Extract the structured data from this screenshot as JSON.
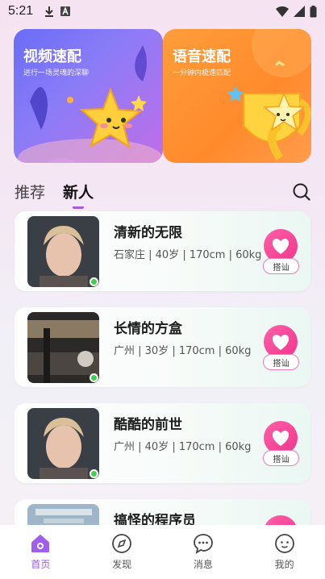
{
  "status_bar": {
    "time": "5:21"
  },
  "promos": [
    {
      "title": "视频速配",
      "subtitle": "进行一场灵魂的深聊"
    },
    {
      "title": "语音速配",
      "subtitle": "一分钟内极速匹配"
    }
  ],
  "tabs": [
    {
      "label": "推荐"
    },
    {
      "label": "新人"
    }
  ],
  "users": [
    {
      "name": "清新的无限",
      "info": "石家庄 | 40岁 | 170cm | 60kg",
      "chat_label": "搭讪"
    },
    {
      "name": "长情的方盒",
      "info": "广州 | 30岁 | 170cm | 60kg",
      "chat_label": "搭讪"
    },
    {
      "name": "酷酷的前世",
      "info": "广州 | 40岁 | 170cm | 60kg",
      "chat_label": "搭讪"
    },
    {
      "name": "搞怪的程序员",
      "info": "",
      "chat_label": ""
    }
  ],
  "nav": [
    {
      "label": "首页"
    },
    {
      "label": "发现"
    },
    {
      "label": "消息"
    },
    {
      "label": "我的"
    }
  ],
  "colors": {
    "accent": "#9a55e4",
    "like": "#f0368c",
    "online": "#3fcf4b"
  }
}
